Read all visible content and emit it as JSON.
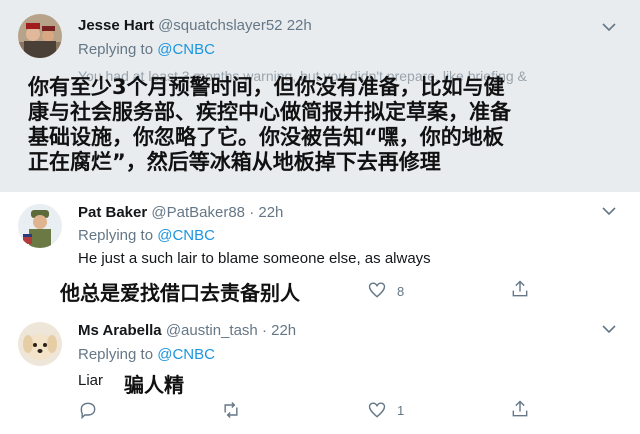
{
  "tweets": [
    {
      "name": "Jesse Hart",
      "handle": "@squatchslayer52",
      "time": "22h",
      "replying_prefix": "Replying to",
      "replying_to": "@CNBC",
      "body": "You had at least 3 months warning, but you didn't prepare, like briefing &",
      "overlay_lines": [
        "你有至少3个月预警时间，但你没有准备，比如与健",
        "康与社会服务部、疾控中心做简报并拟定草案，准备",
        "基础设施，你忽略了它。你没被告知“嘿，你的地板",
        "正在腐烂”，然后等冰箱从地板掉下去再修理"
      ]
    },
    {
      "name": "Pat Baker",
      "handle": "@PatBaker88",
      "dot": "·",
      "time": "22h",
      "replying_prefix": "Replying to",
      "replying_to": "@CNBC",
      "body": "He just a such lair to blame someone else, as always",
      "overlay": "他总是爱找借口去责备别人",
      "like_count": "8"
    },
    {
      "name": "Ms Arabella",
      "handle": "@austin_tash",
      "dot": "·",
      "time": "22h",
      "replying_prefix": "Replying to",
      "replying_to": "@CNBC",
      "body": "Liar",
      "overlay": "骗人精",
      "like_count": "1"
    }
  ],
  "colors": {
    "link": "#1b95e0",
    "muted": "#657786",
    "highlight_bg": "#e8ecef"
  }
}
